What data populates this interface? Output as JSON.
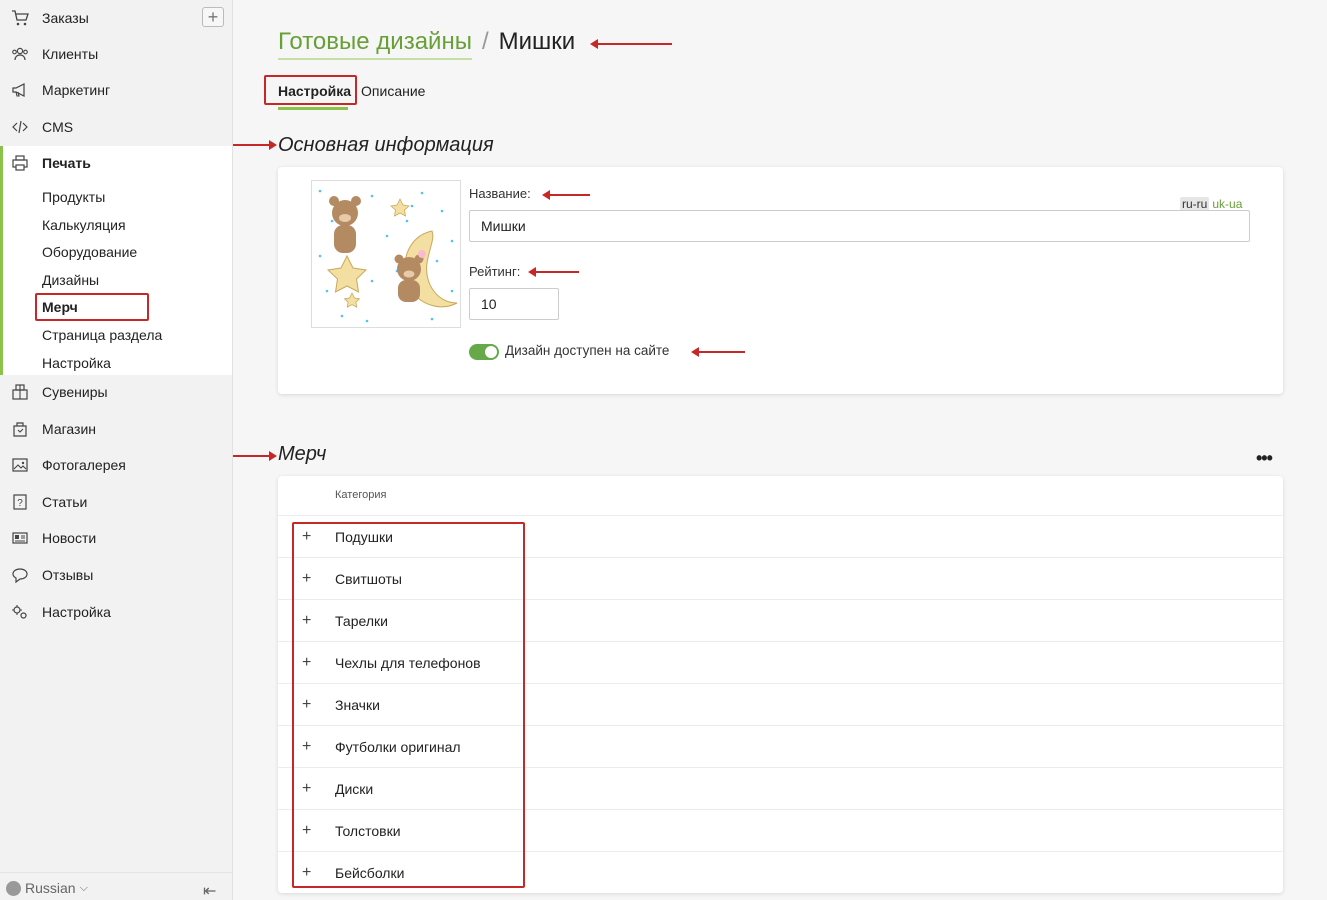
{
  "sidebar": {
    "items": [
      {
        "label": "Заказы",
        "icon": "cart-icon"
      },
      {
        "label": "Клиенты",
        "icon": "users-icon"
      },
      {
        "label": "Маркетинг",
        "icon": "megaphone-icon"
      },
      {
        "label": "CMS",
        "icon": "code-icon"
      },
      {
        "label": "Печать",
        "icon": "printer-icon"
      },
      {
        "label": "Сувениры",
        "icon": "gift-icon"
      },
      {
        "label": "Магазин",
        "icon": "shop-icon"
      },
      {
        "label": "Фотогалерея",
        "icon": "image-icon"
      },
      {
        "label": "Статьи",
        "icon": "question-icon"
      },
      {
        "label": "Новости",
        "icon": "newspaper-icon"
      },
      {
        "label": "Отзывы",
        "icon": "chat-icon"
      },
      {
        "label": "Настройка",
        "icon": "settings-icon"
      }
    ],
    "sub_items": [
      {
        "label": "Продукты"
      },
      {
        "label": "Калькуляция"
      },
      {
        "label": "Оборудование"
      },
      {
        "label": "Дизайны"
      },
      {
        "label": "Мерч"
      },
      {
        "label": "Страница раздела"
      },
      {
        "label": "Настройка"
      }
    ],
    "language": "Russian",
    "accent_color": "#8bc34a"
  },
  "breadcrumb": {
    "link": "Готовые дизайны",
    "separator": "/",
    "current": "Мишки"
  },
  "tabs": [
    {
      "label": "Настройка"
    },
    {
      "label": "Описание"
    }
  ],
  "main_info": {
    "title": "Основная информация",
    "name_label": "Название:",
    "name_value": "Мишки",
    "langs": [
      "ru-ru",
      "uk-ua"
    ],
    "rating_label": "Рейтинг:",
    "rating_value": "10",
    "available_label": "Дизайн доступен на сайте",
    "available": true
  },
  "merch": {
    "title": "Мерч",
    "more": "•••",
    "column_header": "Категория",
    "rows": [
      {
        "category": "Подушки"
      },
      {
        "category": "Свитшоты"
      },
      {
        "category": "Тарелки"
      },
      {
        "category": "Чехлы для телефонов"
      },
      {
        "category": "Значки"
      },
      {
        "category": "Футболки оригинал"
      },
      {
        "category": "Диски"
      },
      {
        "category": "Толстовки"
      },
      {
        "category": "Бейсболки"
      }
    ],
    "expand_symbol": "+"
  }
}
